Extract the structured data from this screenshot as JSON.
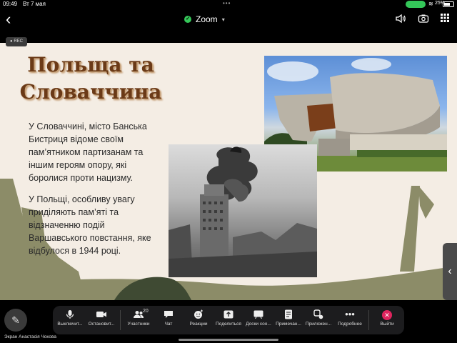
{
  "status_bar": {
    "time": "09:49",
    "date": "Вт 7 мая",
    "battery_percent": "25%"
  },
  "meeting": {
    "title": "Zoom"
  },
  "recording": {
    "label": "REC"
  },
  "slide": {
    "title": "Польща та Словаччина",
    "paragraph_1": "У Словаччині, місто Банська Бистриця відоме своїм пам’ятником партизанам та іншим героям опору, які боролися проти нацизму.",
    "paragraph_2": "У Польщі, особливу увагу приділяють пам’яті та відзначенню подій Варшавського повстання, яке відбулося в 1944 році."
  },
  "toolbar": {
    "mute_label": "Выключит...",
    "video_label": "Остановит...",
    "participants_label": "Участники",
    "participants_count": "20",
    "chat_label": "Чат",
    "reactions_label": "Реакции",
    "share_label": "Поделиться",
    "whiteboards_label": "Доски соо...",
    "notes_label": "Примечан...",
    "apps_label": "Приложен...",
    "more_label": "Подробнее",
    "leave_label": "Выйти"
  },
  "screen_share_label": "Экран Анастасія Чокова",
  "colors": {
    "slide_background": "#f4ede4",
    "title_color": "#6b3a17",
    "hill_color": "#8c8c68",
    "leave_red": "#e0245e",
    "shield_green": "#35c759"
  },
  "icons": {
    "back": "chevron-left-icon",
    "shield": "shield-check-icon",
    "speaker": "speaker-icon",
    "camera_switch": "camera-switch-icon",
    "grid": "grid-view-icon",
    "pencil": "pencil-icon",
    "side_tab": "chevron-left-icon"
  }
}
